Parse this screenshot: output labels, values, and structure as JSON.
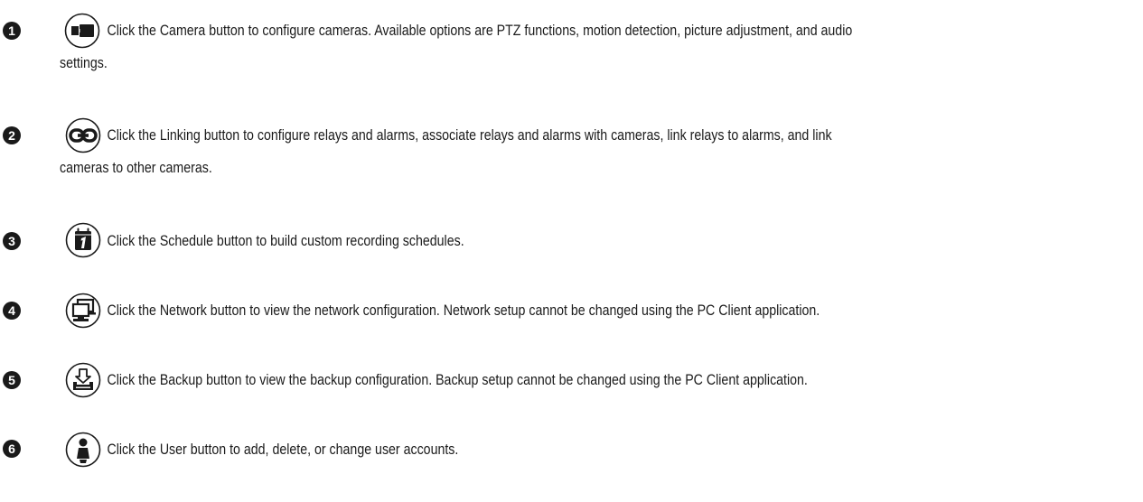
{
  "items": [
    {
      "number": "1",
      "icon": "camera-icon",
      "line1": "Click the Camera button to configure cameras. Available options are PTZ functions, motion detection, picture adjustment, and audio",
      "line2": "settings."
    },
    {
      "number": "2",
      "icon": "link-icon",
      "line1": "Click the Linking button to configure relays and alarms, associate relays and alarms with cameras, link relays to alarms, and link",
      "line2": "cameras to other cameras."
    },
    {
      "number": "3",
      "icon": "calendar-icon",
      "line1": "Click the Schedule button to build custom recording schedules.",
      "line2": ""
    },
    {
      "number": "4",
      "icon": "network-icon",
      "line1": "Click the Network button to view the network configuration. Network setup cannot be changed using the PC Client application.",
      "line2": ""
    },
    {
      "number": "5",
      "icon": "backup-icon",
      "line1": "Click the Backup button to view the backup configuration. Backup setup cannot be changed using the PC Client application.",
      "line2": ""
    },
    {
      "number": "6",
      "icon": "user-icon",
      "line1": "Click the User button to add, delete, or change user accounts.",
      "line2": ""
    }
  ]
}
